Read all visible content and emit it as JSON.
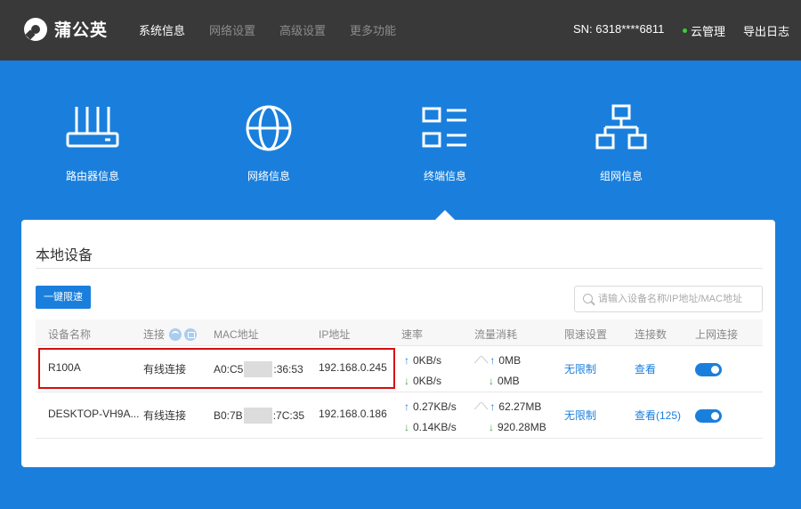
{
  "brand": {
    "name": "蒲公英"
  },
  "nav": [
    {
      "label": "系统信息",
      "active": true
    },
    {
      "label": "网络设置",
      "active": false
    },
    {
      "label": "高级设置",
      "active": false
    },
    {
      "label": "更多功能",
      "active": false
    }
  ],
  "header": {
    "sn": "SN: 6318****6811",
    "cloud_label": "云管理",
    "cloud_status_color": "#36d136",
    "export_label": "导出日志"
  },
  "tiles": [
    {
      "label": "路由器信息",
      "icon": "router-icon"
    },
    {
      "label": "网络信息",
      "icon": "globe-icon"
    },
    {
      "label": "终端信息",
      "icon": "list-icon",
      "active": true
    },
    {
      "label": "组网信息",
      "icon": "network-tree-icon"
    }
  ],
  "panel": {
    "title": "本地设备",
    "limit_button": "一键限速",
    "search_placeholder": "请输入设备名称/IP地址/MAC地址"
  },
  "table": {
    "headers": [
      "设备名称",
      "连接",
      "MAC地址",
      "IP地址",
      "速率",
      "流量消耗",
      "限速设置",
      "连接数",
      "上网连接"
    ],
    "rows": [
      {
        "name": "R100A",
        "connection": "有线连接",
        "mac_prefix": "A0:C5",
        "mac_suffix": ":36:53",
        "ip": "192.168.0.245",
        "rate_up": "0KB/s",
        "rate_down": "0KB/s",
        "traffic_up": "0MB",
        "traffic_down": "0MB",
        "limit": "无限制",
        "connections": "查看",
        "online": true,
        "highlighted": true
      },
      {
        "name": "DESKTOP-VH9A...",
        "connection": "有线连接",
        "mac_prefix": "B0:7B",
        "mac_suffix": ":7C:35",
        "ip": "192.168.0.186",
        "rate_up": "0.27KB/s",
        "rate_down": "0.14KB/s",
        "traffic_up": "62.27MB",
        "traffic_down": "920.28MB",
        "limit": "无限制",
        "connections": "查看(125)",
        "online": true,
        "highlighted": false
      }
    ]
  },
  "colors": {
    "accent": "#1a7fdc",
    "topbar": "#393939",
    "highlight_border": "#d60e0e"
  }
}
